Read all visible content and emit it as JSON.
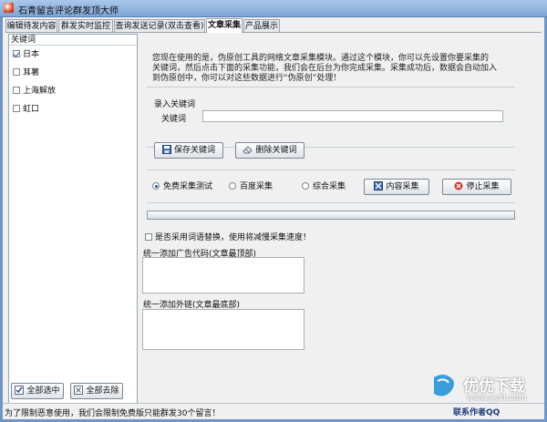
{
  "window": {
    "title": "石青留言评论群发顶大师"
  },
  "tabs": [
    {
      "label": "编辑待发内容"
    },
    {
      "label": "群发实时监控"
    },
    {
      "label": "查询发送记录(双击查看)"
    },
    {
      "label": "文章采集"
    },
    {
      "label": "产品展示"
    }
  ],
  "active_tab": "文章采集",
  "keywords": {
    "header": "关键词",
    "items": [
      {
        "label": "日本",
        "checked": true
      },
      {
        "label": "耳薯",
        "checked": false
      },
      {
        "label": "上海解放",
        "checked": false
      },
      {
        "label": "虹口",
        "checked": false
      }
    ],
    "select_all_label": "全部选中",
    "deselect_all_label": "全部去除"
  },
  "intro": {
    "line1": "您现在使用的是，伪原创工具的网络文章采集模块。通过这个模块，你可以先设置你要采集的",
    "line2": "关键词，然后点击下面的采集功能，我们会在后台为你完成采集。采集成功后，数据会自动加入",
    "line3": "到伪原创中，你可以对这些数据进行“伪原创”处理！"
  },
  "input_keyword": {
    "section_label": "录入关键词",
    "field_label": "关键词",
    "value": "",
    "placeholder": ""
  },
  "buttons": {
    "save_keyword": "保存关键词",
    "delete_keyword": "删除关键词",
    "content_collect": "内容采集",
    "stop_collect": "停止采集"
  },
  "collect_modes": {
    "options": [
      "免费采集测试",
      "百度采集",
      "综合采集"
    ],
    "selected": "免费采集测试"
  },
  "progress": {
    "value": 0
  },
  "synonym_replace": {
    "checked": false,
    "label": "是否采用词语替换，使用将减慢采集速度！"
  },
  "ad_code": {
    "label": "统一添加广告代码(文章最顶部)",
    "value": ""
  },
  "ext_link": {
    "label": "统一添加外链(文章最底部)",
    "value": ""
  },
  "status": {
    "text": "为了限制恶意使用，我们会限制免费版只能群发30个留言！",
    "contact": "联系作者QQ"
  },
  "watermark": {
    "text": "优优下载",
    "url": "www.yyxt.com"
  },
  "colors": {
    "accent": "#1d4fa0",
    "stop_icon": "#d8352a",
    "watermark_blue": "#1a8ed8",
    "titlebar": "#7ea6d6"
  }
}
